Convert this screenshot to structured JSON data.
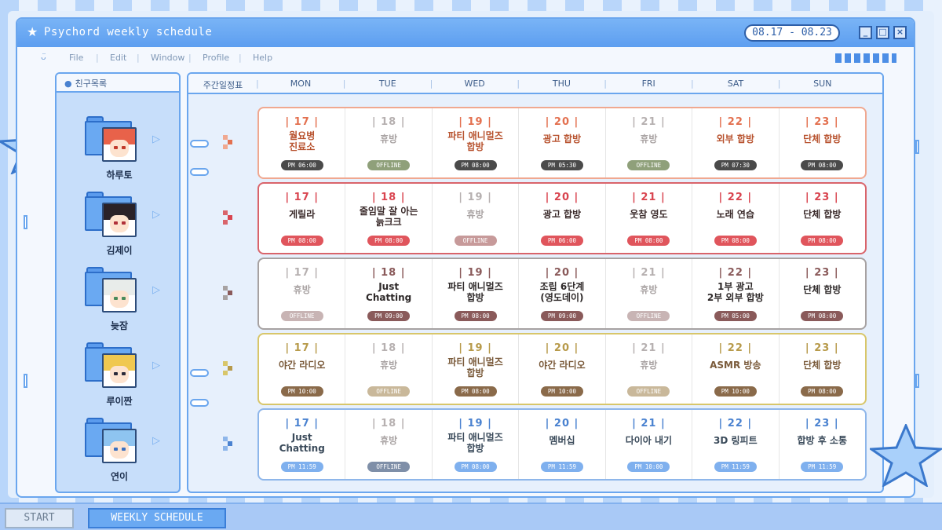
{
  "window": {
    "title": "Psychord weekly schedule",
    "date_range": "08.17 - 08.23",
    "minimize": "_",
    "maximize": "□",
    "close": "×"
  },
  "menu": {
    "items": [
      "File",
      "Edit",
      "Window",
      "Profile",
      "Help"
    ]
  },
  "sidebar": {
    "title": "친구목록",
    "friends": [
      {
        "name": "하루토"
      },
      {
        "name": "김제이"
      },
      {
        "name": "늦잠"
      },
      {
        "name": "루이짠"
      },
      {
        "name": "연이"
      }
    ]
  },
  "schedule": {
    "header_label": "주간일정표",
    "days": [
      "MON",
      "TUE",
      "WED",
      "THU",
      "FRI",
      "SAT",
      "SUN"
    ],
    "rows": [
      {
        "border": "#f0a890",
        "accent": "#e3704f",
        "text": "#b8532f",
        "time_bg": "#4a4a4a",
        "off_bg": "#8fa07a",
        "cells": [
          {
            "day": "| 17 |",
            "act": "월요병\n진료소",
            "time": "PM 06:00",
            "off": false
          },
          {
            "day": "| 18 |",
            "act": "휴방",
            "time": "OFFLINE",
            "off": true
          },
          {
            "day": "| 19 |",
            "act": "파티 애니멀즈\n합방",
            "time": "PM 08:00",
            "off": false
          },
          {
            "day": "| 20 |",
            "act": "광고 합방",
            "time": "PM 05:30",
            "off": false
          },
          {
            "day": "| 21 |",
            "act": "휴방",
            "time": "OFFLINE",
            "off": true
          },
          {
            "day": "| 22 |",
            "act": "외부 합방",
            "time": "PM 07:30",
            "off": false
          },
          {
            "day": "| 23 |",
            "act": "단체 합방",
            "time": "PM 08:00",
            "off": false
          }
        ]
      },
      {
        "border": "#d9646b",
        "accent": "#d9444f",
        "text": "#3a2a2a",
        "time_bg": "#e0555c",
        "off_bg": "#c79a9a",
        "cells": [
          {
            "day": "| 17 |",
            "act": "게릴라",
            "time": "PM 08:00",
            "off": false
          },
          {
            "day": "| 18 |",
            "act": "줄임말 잘 아는\n늙크크",
            "time": "PM 08:00",
            "off": false
          },
          {
            "day": "| 19 |",
            "act": "휴방",
            "time": "OFFLINE",
            "off": true
          },
          {
            "day": "| 20 |",
            "act": "광고 합방",
            "time": "PM 06:00",
            "off": false
          },
          {
            "day": "| 21 |",
            "act": "웃참 영도",
            "time": "PM 08:00",
            "off": false
          },
          {
            "day": "| 22 |",
            "act": "노래 연습",
            "time": "PM 08:00",
            "off": false
          },
          {
            "day": "| 23 |",
            "act": "단체 합방",
            "time": "PM 08:00",
            "off": false
          }
        ]
      },
      {
        "border": "#a7a2a2",
        "accent": "#8a5a5a",
        "text": "#2f2a2a",
        "time_bg": "#8a5a5a",
        "off_bg": "#c8b4b4",
        "cells": [
          {
            "day": "| 17 |",
            "act": "휴방",
            "time": "OFFLINE",
            "off": true
          },
          {
            "day": "| 18 |",
            "act": "Just\nChatting",
            "time": "PM 09:00",
            "off": false
          },
          {
            "day": "| 19 |",
            "act": "파티 애니멀즈\n합방",
            "time": "PM 08:00",
            "off": false
          },
          {
            "day": "| 20 |",
            "act": "조립 6단계\n(영도데이)",
            "time": "PM 09:00",
            "off": false
          },
          {
            "day": "| 21 |",
            "act": "휴방",
            "time": "OFFLINE",
            "off": true
          },
          {
            "day": "| 22 |",
            "act": "1부 광고\n2부 외부 합방",
            "time": "PM 05:00",
            "off": false
          },
          {
            "day": "| 23 |",
            "act": "단체 합방",
            "time": "PM 08:00",
            "off": false
          }
        ]
      },
      {
        "border": "#d8c66a",
        "accent": "#b79a4a",
        "text": "#7a5a3a",
        "time_bg": "#8a6a4a",
        "off_bg": "#c9b89a",
        "cells": [
          {
            "day": "| 17 |",
            "act": "야간 라디오",
            "time": "PM 10:00",
            "off": false
          },
          {
            "day": "| 18 |",
            "act": "휴방",
            "time": "OFFLINE",
            "off": true
          },
          {
            "day": "| 19 |",
            "act": "파티 애니멀즈\n합방",
            "time": "PM 08:00",
            "off": false
          },
          {
            "day": "| 20 |",
            "act": "야간 라디오",
            "time": "PM 10:00",
            "off": false
          },
          {
            "day": "| 21 |",
            "act": "휴방",
            "time": "OFFLINE",
            "off": true
          },
          {
            "day": "| 22 |",
            "act": "ASMR 방송",
            "time": "PM 10:00",
            "off": false
          },
          {
            "day": "| 23 |",
            "act": "단체 합방",
            "time": "PM 08:00",
            "off": false
          }
        ]
      },
      {
        "border": "#8eb6ea",
        "accent": "#4a82d0",
        "text": "#3a4a5a",
        "time_bg": "#7fb0ee",
        "off_bg": "#7f8fa8",
        "cells": [
          {
            "day": "| 17 |",
            "act": "Just\nChatting",
            "time": "PM 11:59",
            "off": false
          },
          {
            "day": "| 18 |",
            "act": "휴방",
            "time": "OFFLINE",
            "off": true
          },
          {
            "day": "| 19 |",
            "act": "파티 애니멀즈\n합방",
            "time": "PM 08:00",
            "off": false
          },
          {
            "day": "| 20 |",
            "act": "멤버십",
            "time": "PM 11:59",
            "off": false
          },
          {
            "day": "| 21 |",
            "act": "다이아 내기",
            "time": "PM 10:00",
            "off": false
          },
          {
            "day": "| 22 |",
            "act": "3D 링피트",
            "time": "PM 11:59",
            "off": false
          },
          {
            "day": "| 23 |",
            "act": "합방 후 소통",
            "time": "PM 11:59",
            "off": false
          }
        ]
      }
    ]
  },
  "avatars": [
    {
      "hair": "#e8624a",
      "eye": "#c23a2a"
    },
    {
      "hair": "#2a2228",
      "eye": "#b0303a"
    },
    {
      "hair": "#e8ecea",
      "eye": "#4a8a5a"
    },
    {
      "hair": "#f0c850",
      "eye": "#2a2a3a"
    },
    {
      "hair": "#8ec4f0",
      "eye": "#3a70c0"
    }
  ],
  "taskbar": {
    "start": "START",
    "active_task": "WEEKLY SCHEDULE"
  },
  "colors": {
    "accent": "#5d9ef0",
    "dark_accent": "#2e5fa8"
  }
}
